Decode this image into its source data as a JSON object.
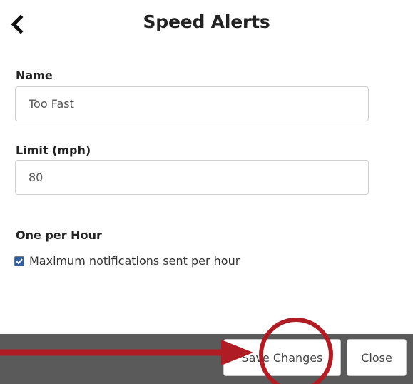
{
  "header": {
    "title": "Speed Alerts",
    "back_icon": "chevron-left-icon"
  },
  "form": {
    "name": {
      "label": "Name",
      "value": "Too Fast"
    },
    "limit": {
      "label": "Limit (mph)",
      "value": "80"
    },
    "one_per_hour": {
      "label": "One per Hour",
      "checkbox_label": "Maximum notifications sent per hour",
      "checked": true
    }
  },
  "footer": {
    "save_label": "Save Changes",
    "close_label": "Close"
  },
  "colors": {
    "annotation": "#b01c24",
    "footer_bg": "#5a5a5a",
    "checkbox_fill": "#2f5f9e"
  }
}
